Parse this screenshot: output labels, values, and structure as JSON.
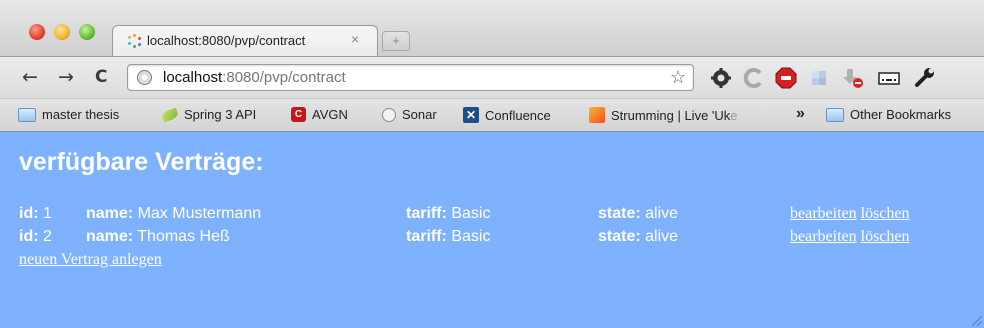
{
  "browser": {
    "tab": {
      "title": "localhost:8080/pvp/contract",
      "close": "×"
    },
    "new_tab": "+",
    "nav": {
      "back": "←",
      "forward": "→",
      "reload": "C"
    },
    "omnibox": {
      "host": "localhost",
      "path": ":8080/pvp/contract"
    },
    "star": "☆",
    "bookmarks": [
      {
        "label": "master thesis",
        "icon": "folder-icon"
      },
      {
        "label": "Spring 3 API",
        "icon": "leaf-icon"
      },
      {
        "label": "AVGN",
        "icon": "avgn-icon"
      },
      {
        "label": "Sonar",
        "icon": "sonar-icon"
      },
      {
        "label": "Confluence",
        "icon": "confluence-icon"
      },
      {
        "label": "Strumming | Live 'Uk",
        "faded": "e",
        "icon": "strum-icon"
      }
    ],
    "more_bookmarks": "»",
    "other_bookmarks": "Other Bookmarks",
    "colors": {
      "page_bg": "#7eb2ff",
      "chrome_bg": "#d6d6d6"
    }
  },
  "page": {
    "title": "verfügbare Verträge:",
    "labels": {
      "id": "id:",
      "name": "name:",
      "tariff": "tariff:",
      "state": "state:"
    },
    "contracts": [
      {
        "id": "1",
        "name": "Max Mustermann",
        "tariff": "Basic",
        "state": "alive",
        "edit": "bearbeiten",
        "delete": "löschen"
      },
      {
        "id": "2",
        "name": "Thomas Heß",
        "tariff": "Basic",
        "state": "alive",
        "edit": "bearbeiten",
        "delete": "löschen"
      }
    ],
    "new_contract": "neuen Vertrag anlegen"
  }
}
